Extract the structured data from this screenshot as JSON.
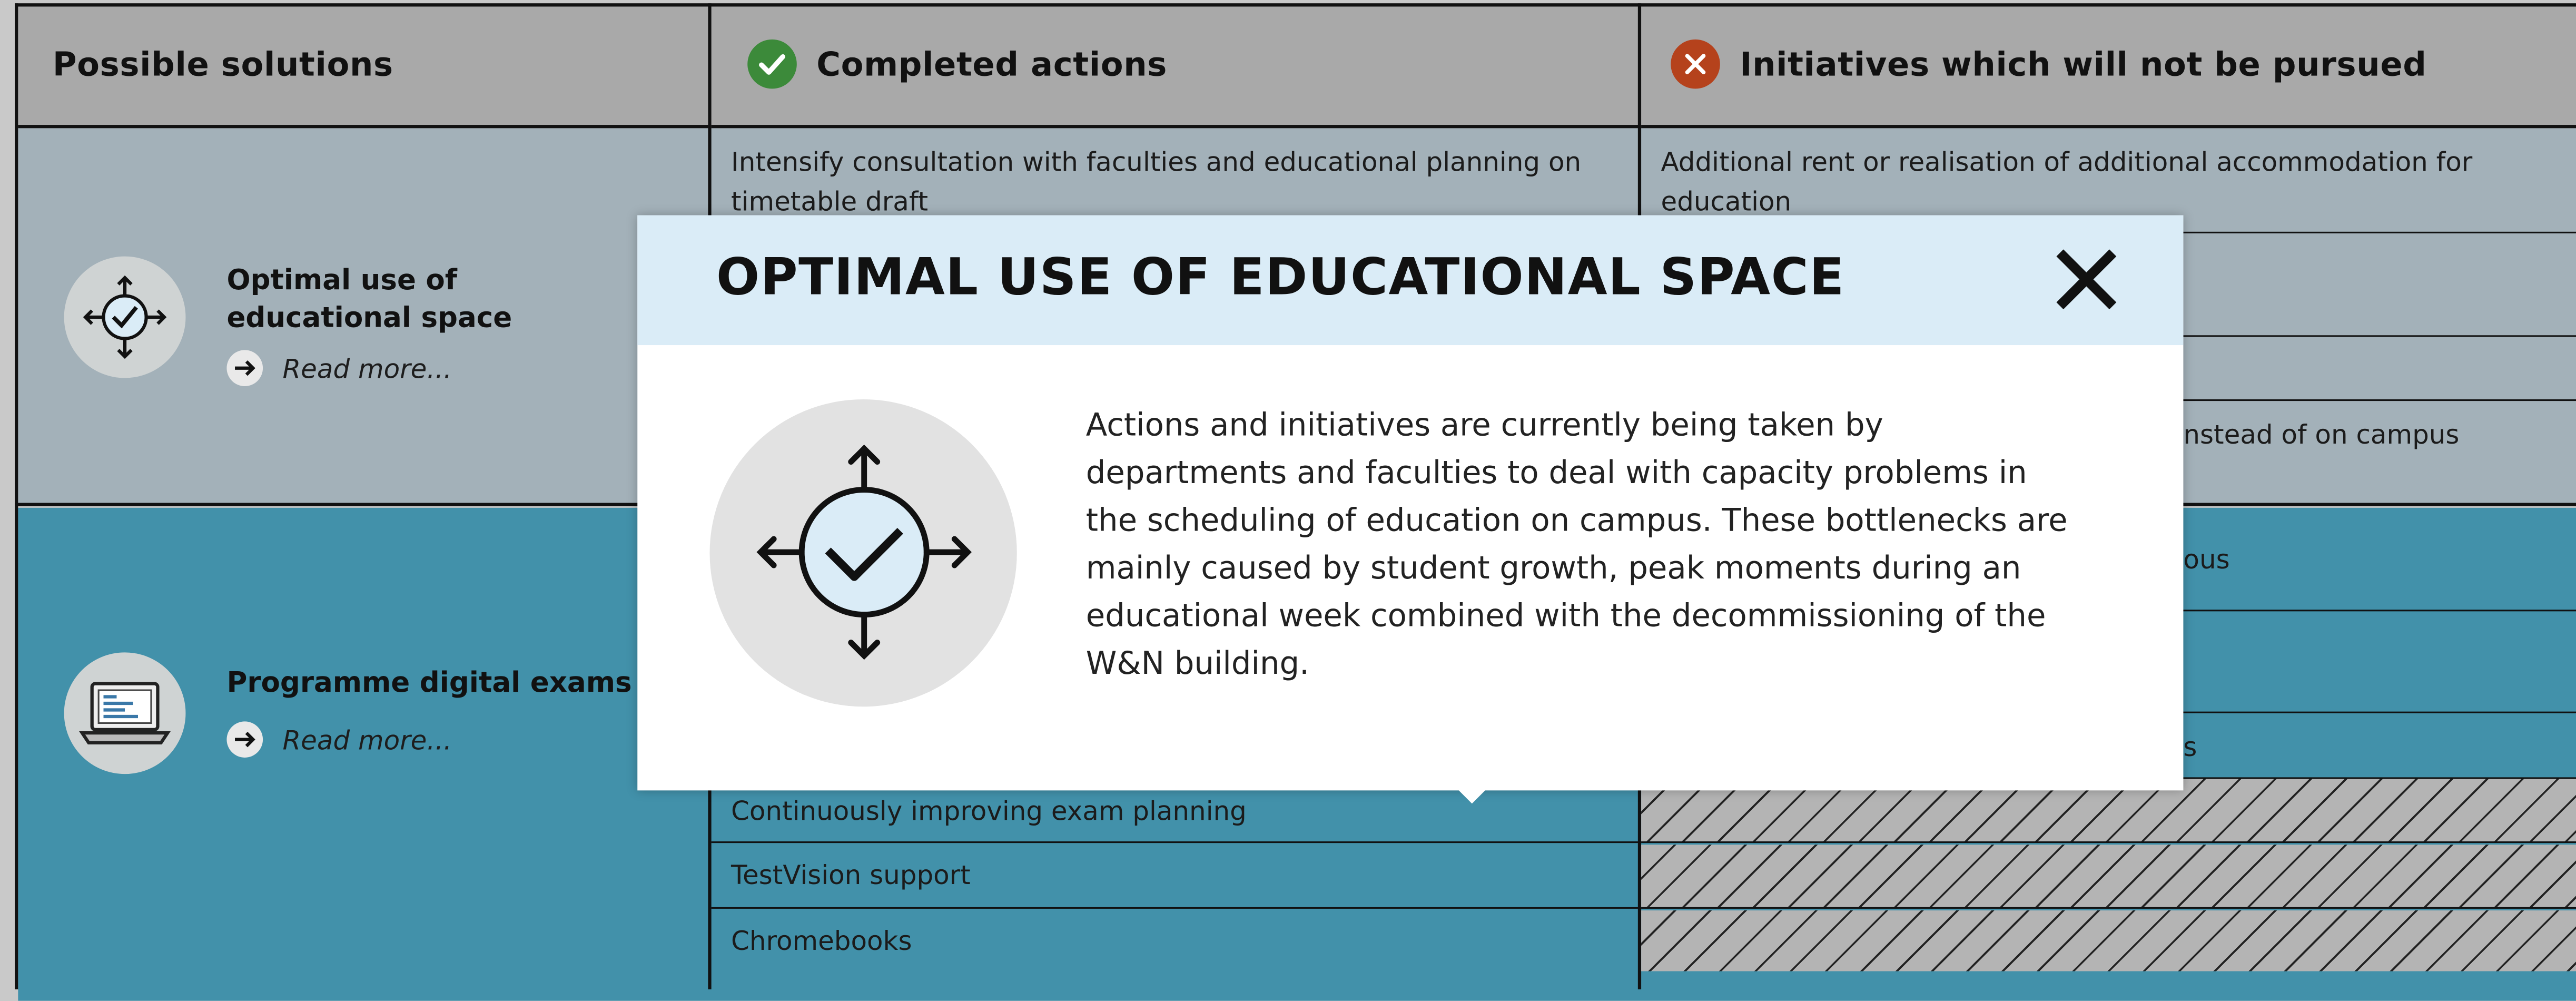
{
  "headers": {
    "solutions": "Possible solutions",
    "completed": "Completed actions",
    "not_pursued": "Initiatives which will not be pursued"
  },
  "colors": {
    "header_bg": "#a9a9a9",
    "band1_bg": "#a3b1b9",
    "band2_bg": "#4291aa",
    "completed_icon": "#3c8a3a",
    "not_pursued_icon": "#b5421c",
    "modal_header_bg": "#daecf7"
  },
  "solutions": [
    {
      "title_line1": "Optimal use of",
      "title_line2": "educational space",
      "read_more": "Read more...",
      "icon": "arrows-check-icon"
    },
    {
      "title": "Programme digital exams",
      "read_more": "Read more...",
      "icon": "laptop-icon"
    }
  ],
  "completed_actions": {
    "row1_line1": "Intensify consultation with faculties and educational planning on",
    "row1_line2": "timetable draft",
    "exam_rows": [
      "Continuously improving exam planning",
      "TestVision support",
      "Chromebooks"
    ]
  },
  "not_pursued": {
    "row1_line1": "Additional rent or realisation of additional accommodation for",
    "row1_line2": "education",
    "row4_fragment": "nstead of on campus",
    "row5_fragment": "ous",
    "row7_fragment": "s"
  },
  "modal": {
    "title": "OPTIMAL USE OF EDUCATIONAL SPACE",
    "close_icon": "close-icon",
    "icon": "arrows-check-icon",
    "body": "Actions and initiatives are currently being taken by departments and faculties to deal with capacity problems in the scheduling of education on campus. These bottlenecks are mainly caused by student growth, peak moments during an educational week combined with the decommissioning of the W&N building."
  }
}
